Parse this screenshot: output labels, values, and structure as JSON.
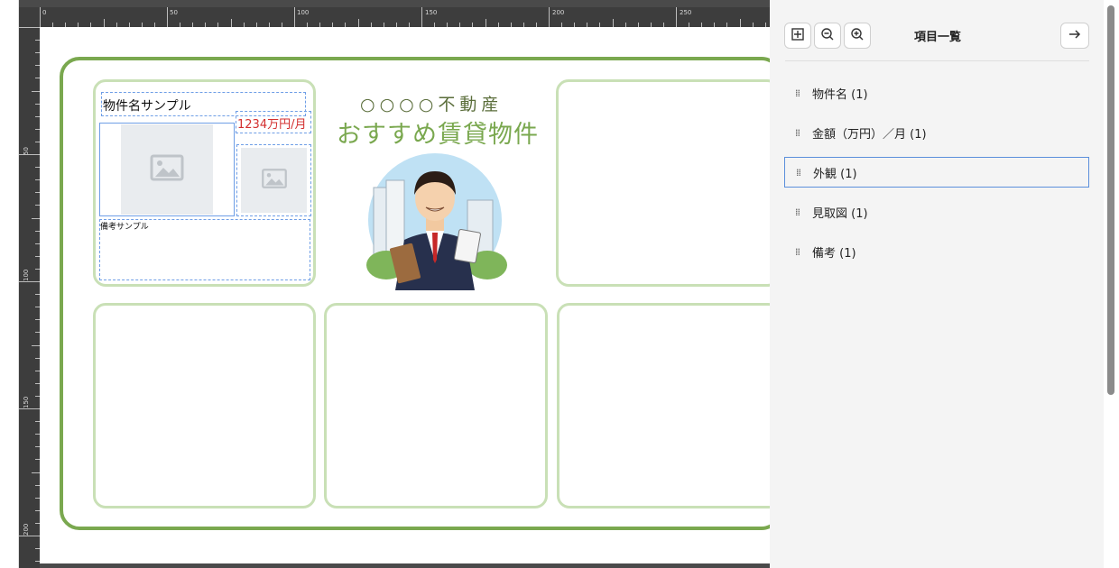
{
  "ruler": {
    "h_labels": [
      "0",
      "50",
      "100",
      "150",
      "200",
      "250"
    ],
    "v_labels": [
      "50",
      "100",
      "150",
      "200"
    ]
  },
  "flyer": {
    "company": "○○○○不動産",
    "headline": "おすすめ賃貸物件",
    "card": {
      "property_name": "物件名サンプル",
      "price": "1234万円/月",
      "note": "備考サンプル"
    },
    "colors": {
      "frame": "#7aa84f",
      "cell_border": "#c9e0b6",
      "price": "#d32f2f"
    }
  },
  "panel": {
    "title": "項目一覧",
    "toolbar": {
      "fit_icon": "fit-frame-icon",
      "zoom_out_icon": "zoom-out-icon",
      "zoom_in_icon": "zoom-in-icon",
      "next_icon": "arrow-right-icon"
    },
    "items": [
      {
        "label": "物件名 (1)",
        "selected": false
      },
      {
        "label": "金額（万円）／月 (1)",
        "selected": false
      },
      {
        "label": "外観 (1)",
        "selected": true
      },
      {
        "label": "見取図 (1)",
        "selected": false
      },
      {
        "label": "備考 (1)",
        "selected": false
      }
    ]
  }
}
